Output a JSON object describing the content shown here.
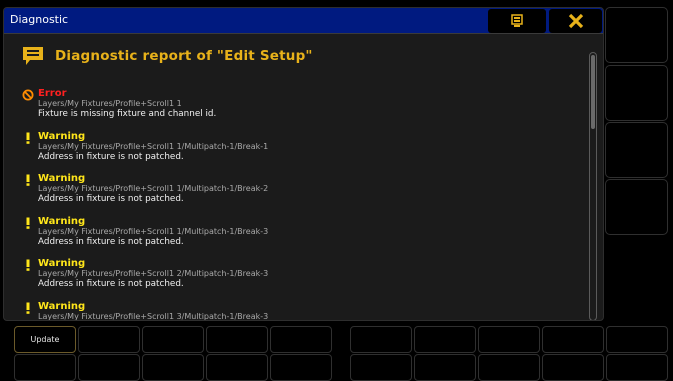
{
  "window": {
    "title": "Diagnostic",
    "heading": "Diagnostic report of \"Edit Setup\""
  },
  "titlebar_buttons": [
    {
      "name": "pin-button",
      "icon": "monitor-icon"
    },
    {
      "name": "close-button",
      "icon": "close-icon"
    }
  ],
  "entries": [
    {
      "level": "Error",
      "icon": "error-icon",
      "path": "Layers/My Fixtures/Profile+Scroll1 1",
      "message": "Fixture is missing fixture and channel id."
    },
    {
      "level": "Warning",
      "icon": "warning-icon",
      "path": "Layers/My Fixtures/Profile+Scroll1 1/Multipatch-1/Break-1",
      "message": "Address in fixture is not patched."
    },
    {
      "level": "Warning",
      "icon": "warning-icon",
      "path": "Layers/My Fixtures/Profile+Scroll1 1/Multipatch-1/Break-2",
      "message": "Address in fixture is not patched."
    },
    {
      "level": "Warning",
      "icon": "warning-icon",
      "path": "Layers/My Fixtures/Profile+Scroll1 1/Multipatch-1/Break-3",
      "message": "Address in fixture is not patched."
    },
    {
      "level": "Warning",
      "icon": "warning-icon",
      "path": "Layers/My Fixtures/Profile+Scroll1 2/Multipatch-1/Break-3",
      "message": "Address in fixture is not patched."
    },
    {
      "level": "Warning",
      "icon": "warning-icon",
      "path": "Layers/My Fixtures/Profile+Scroll1 3/Multipatch-1/Break-3",
      "message": ""
    }
  ],
  "bottom_bar": {
    "update_label": "Update"
  },
  "colors": {
    "titlebar": "#001a80",
    "heading": "#e8b21a",
    "error": "#ff2020",
    "warning": "#ffe61a"
  }
}
